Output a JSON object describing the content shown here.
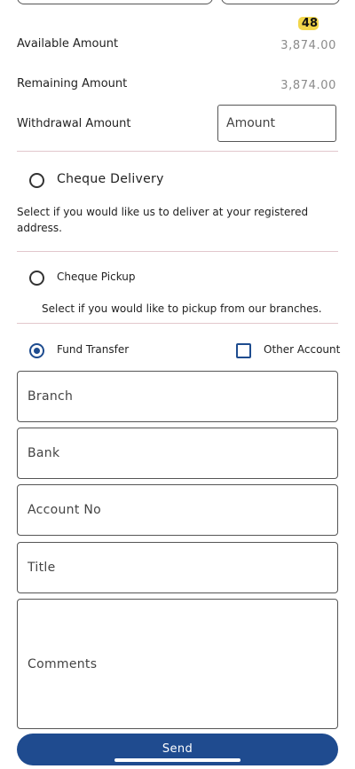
{
  "header": {
    "badge": "48"
  },
  "summary": {
    "available_label": "Available Amount",
    "available_value": "3,874.00",
    "remaining_label": "Remaining Amount",
    "remaining_value": "3,874.00",
    "withdrawal_label": "Withdrawal Amount",
    "withdrawal_placeholder": "Amount",
    "withdrawal_value": ""
  },
  "options": {
    "cheque_delivery": {
      "label": "Cheque Delivery",
      "description": "Select if you would like us to deliver at your registered address.",
      "selected": false
    },
    "cheque_pickup": {
      "label": "Cheque Pickup",
      "description": "Select if you would like to pickup from our branches.",
      "selected": false
    },
    "fund_transfer": {
      "label": "Fund Transfer",
      "selected": true
    },
    "other_account": {
      "label": "Other Account",
      "checked": false
    }
  },
  "form": {
    "branch_placeholder": "Branch",
    "bank_placeholder": "Bank",
    "account_no_placeholder": "Account No",
    "title_placeholder": "Title",
    "comments_placeholder": "Comments"
  },
  "actions": {
    "send_label": "Send"
  },
  "colors": {
    "primary": "#1f4b8f",
    "badge": "#f2d64b",
    "divider": "#e2c7cc"
  }
}
